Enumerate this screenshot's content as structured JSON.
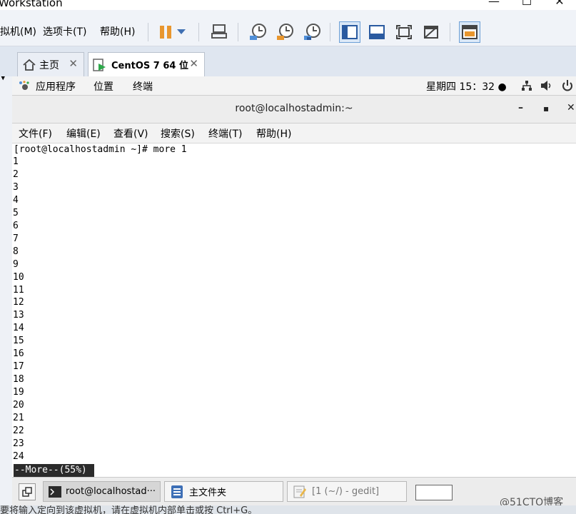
{
  "vmware": {
    "title": "Workstation",
    "window_controls": [
      "—",
      "☐",
      "✕"
    ],
    "menus": [
      "虚拟机(M)",
      "选项卡(T)",
      "帮助(H)"
    ],
    "tabs": [
      {
        "label": "主页",
        "active": false
      },
      {
        "label": "CentOS 7 64 位",
        "active": true
      }
    ]
  },
  "gnome_bar": {
    "apps": "应用程序",
    "places": "位置",
    "terminal": "终端",
    "clock": "星期四 15：32 ●"
  },
  "terminal": {
    "title": "root@localhostadmin:~",
    "menus": [
      "文件(F)",
      "编辑(E)",
      "查看(V)",
      "搜索(S)",
      "终端(T)",
      "帮助(H)"
    ],
    "prompt": "[root@localhostadmin ~]# more 1",
    "lines": [
      "1",
      "2",
      "3",
      "4",
      "5",
      "6",
      "7",
      "8",
      "9",
      "10",
      "11",
      "12",
      "13",
      "14",
      "15",
      "16",
      "17",
      "18",
      "19",
      "20",
      "21",
      "22",
      "23",
      "24"
    ],
    "more_status": "--More--(55%)"
  },
  "taskbar": {
    "items": [
      {
        "label": "root@localhostad···",
        "active": true
      },
      {
        "label": "主文件夹",
        "active": false
      },
      {
        "label": "[1 (~/) - gedit]",
        "active": false
      }
    ]
  },
  "status_text": "要将输入定向到该虚拟机，请在虚拟机内部单击或按 Ctrl+G。",
  "watermark": "@51CTO博客",
  "colors": {
    "accent": "#4f8fd8",
    "pause": "#e8962e",
    "more_bar": "#2b2b2b"
  }
}
